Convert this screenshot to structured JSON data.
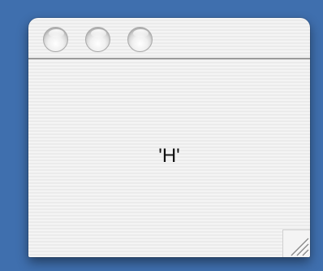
{
  "window": {
    "content_text": "'H'",
    "controls": [
      {
        "name": "close",
        "icon": "close-circle-icon"
      },
      {
        "name": "minimize",
        "icon": "minimize-circle-icon"
      },
      {
        "name": "zoom",
        "icon": "zoom-circle-icon"
      }
    ],
    "resize_icon": "resize-grip-icon"
  },
  "colors": {
    "desktop": "#3f6fae",
    "window_bg": "#f2f2f2",
    "separator": "#9a9a9a"
  }
}
